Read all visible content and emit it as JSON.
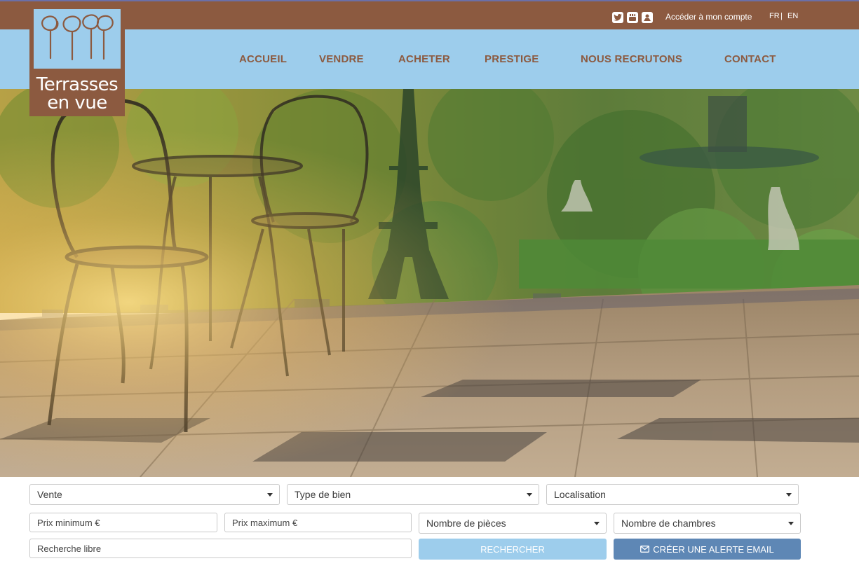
{
  "logo": {
    "line1": "Terrasses",
    "line2": "en vue"
  },
  "topbar": {
    "social": [
      "twitter-icon",
      "youtube-icon",
      "user-icon"
    ],
    "account": "Accéder à mon compte",
    "lang_fr": "FR",
    "lang_sep": "|",
    "lang_en": "EN"
  },
  "nav": [
    "ACCUEIL",
    "VENDRE",
    "ACHETER",
    "PRESTIGE",
    "NOUS RECRUTONS",
    "CONTACT"
  ],
  "search": {
    "transaction": "Vente",
    "property_type": "Type de bien",
    "location": "Localisation",
    "price_min": "Prix minimum €",
    "price_max": "Prix maximum €",
    "rooms": "Nombre de pièces",
    "bedrooms": "Nombre de chambres",
    "free_text": "Recherche libre",
    "search_button": "RECHERCHER",
    "alert_button": "CRÉER UNE ALERTE EMAIL"
  },
  "colors": {
    "brown": "#8c5a40",
    "light_blue": "#9dcdec",
    "button_blue": "#5e87b5"
  }
}
